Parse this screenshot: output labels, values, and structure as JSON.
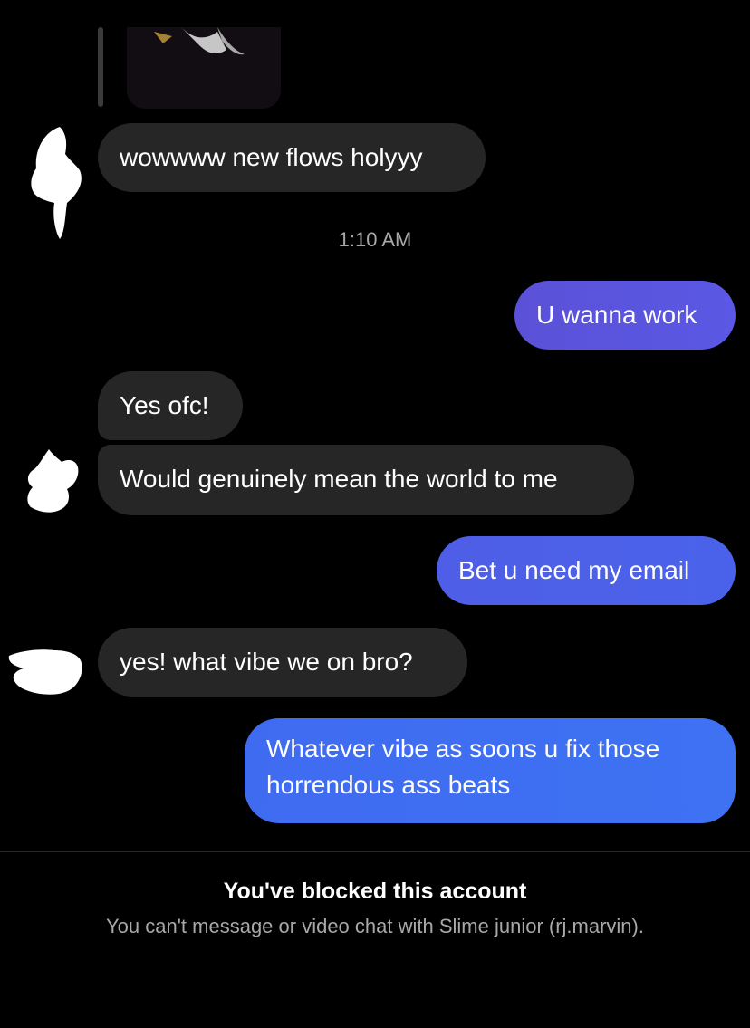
{
  "thread": {
    "timestamp": "1:10 AM",
    "messages": [
      {
        "sender": "them",
        "text": "wowwww new flows holyyy"
      },
      {
        "sender": "me",
        "text": "U wanna work"
      },
      {
        "sender": "them",
        "text": "Yes ofc!"
      },
      {
        "sender": "them",
        "text": "Would genuinely mean the world to me"
      },
      {
        "sender": "me",
        "text": "Bet u need my email"
      },
      {
        "sender": "them",
        "text": "yes! what vibe we on bro?"
      },
      {
        "sender": "me",
        "text_line1": "Whatever vibe as soons u fix those",
        "text_line2": "horrendous ass beats"
      }
    ]
  },
  "blocked_notice": {
    "title": "You've blocked this account",
    "subtitle": "You can't message or video chat with Slime junior (rj.marvin)."
  },
  "colors": {
    "incoming_bubble": "#262626",
    "outgoing_gradient_start": "#5b51d8",
    "outgoing_gradient_end": "#3f6ff2",
    "background": "#000000",
    "muted_text": "#a8a8a8"
  }
}
